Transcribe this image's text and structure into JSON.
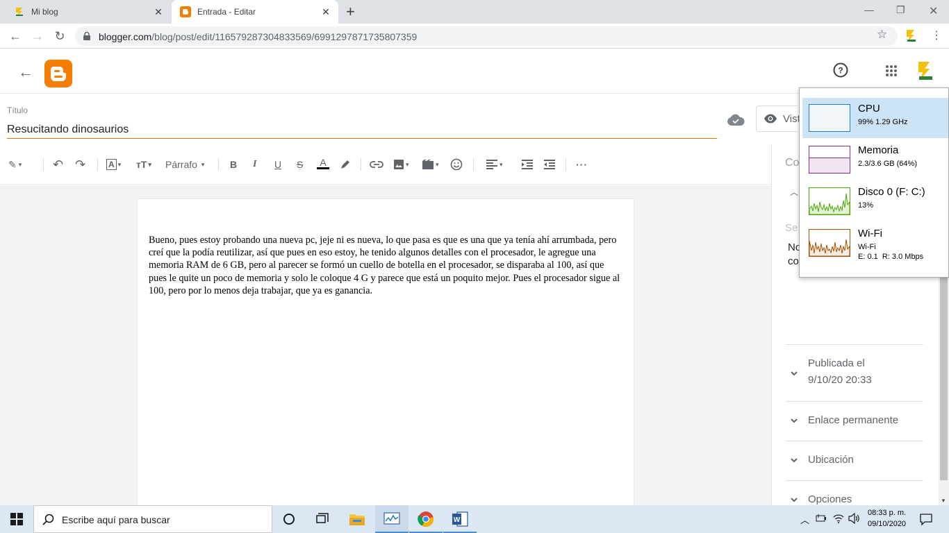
{
  "browser": {
    "tabs": [
      {
        "title": "Mi blog",
        "active": false
      },
      {
        "title": "Entrada - Editar",
        "active": true
      }
    ],
    "url_host": "blogger.com",
    "url_path": "/blog/post/edit/1165792873048335​69/6991297871735807359"
  },
  "editor": {
    "title_label": "Título",
    "title_value": "Resucitando dinosaurios",
    "preview_label": "Vist",
    "paragraph_style": "Párrafo",
    "body_text": "Bueno, pues estoy probando una nueva pc, jeje ni es nueva, lo que pasa es que es una que ya tenía ahí arrumbada, pero creí que la podía reutilizar, así que pues en eso estoy, he tenido algunos detalles con el procesador, le agregue una memoria RAM de 6 GB, pero al parecer se formó un cuello de botella en el procesador, se disparaba al 100, así que pues le quite un poco de memoria y solo le coloque 4 G y parece que está un poquito mejor. Pues el procesador sigue al 100, pero por lo menos deja trabajar, que ya es ganancia."
  },
  "settings_panel": {
    "partial_top": "Co",
    "partial_search": "Se",
    "partial_text_1": "No",
    "partial_text_2": "co",
    "published_label": "Publicada el",
    "published_date": "9/10/20 20:33",
    "permalink_label": "Enlace permanente",
    "location_label": "Ubicación",
    "options_label": "Opciones"
  },
  "task_manager": [
    {
      "name": "CPU",
      "detail": "99%  1.29 GHz",
      "color": "#1f7dcc",
      "selected": true
    },
    {
      "name": "Memoria",
      "detail": "2.3/3.6 GB (64%)",
      "color": "#8b2e8b",
      "selected": false
    },
    {
      "name": "Disco 0 (F: C:)",
      "detail": "13%",
      "color": "#4da60c",
      "selected": false
    },
    {
      "name": "Wi-Fi",
      "detail": "Wi-Fi",
      "detail2_e": "E: 0.1",
      "detail2_r": "R: 3.0 Mbps",
      "color": "#a74f01",
      "selected": false
    }
  ],
  "taskbar": {
    "search_placeholder": "Escribe aquí para buscar",
    "time": "08:33 p. m.",
    "date": "09/10/2020"
  },
  "colors": {
    "blogger_orange": "#f57d00",
    "title_underline": "#e37400",
    "taskbar_bg": "#dbe7f2"
  }
}
